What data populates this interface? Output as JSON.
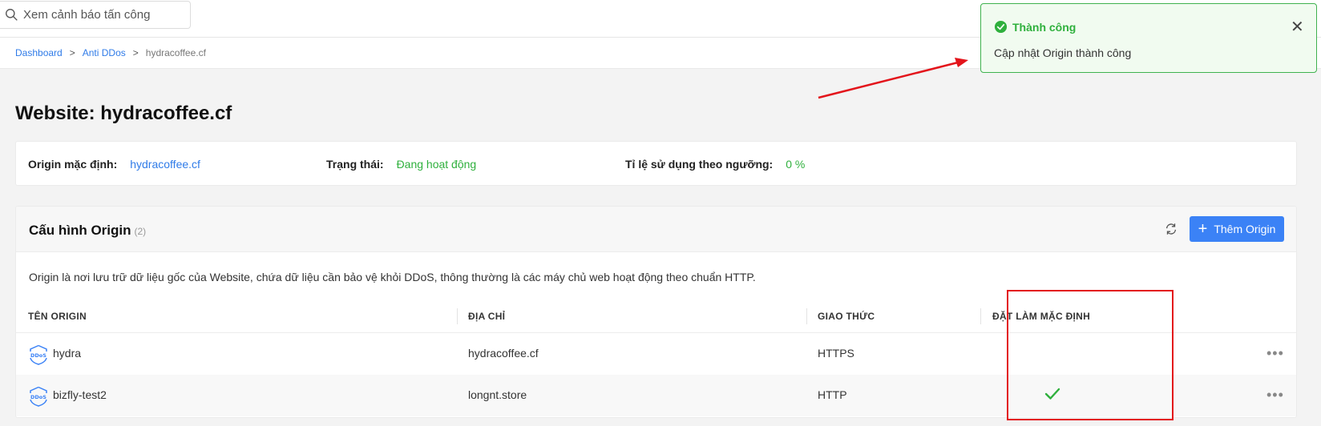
{
  "search": {
    "placeholder": "Xem cảnh báo tấn công"
  },
  "breadcrumb": {
    "items": [
      "Dashboard",
      "Anti DDos"
    ],
    "separator": ">",
    "current": "hydracoffee.cf"
  },
  "page": {
    "title": "Website: hydracoffee.cf"
  },
  "info": {
    "origin_label": "Origin mặc định:",
    "origin_value": "hydracoffee.cf",
    "status_label": "Trạng thái:",
    "status_value": "Đang hoạt động",
    "usage_label": "Tỉ lệ sử dụng theo ngưỡng:",
    "usage_value": "0 %"
  },
  "config": {
    "title": "Cấu hình Origin",
    "count": "(2)",
    "add_button": "Thêm Origin",
    "description": "Origin là nơi lưu trữ dữ liệu gốc của Website, chứa dữ liệu cần bảo vệ khỏi DDoS, thông thường là các máy chủ web hoạt động theo chuẩn HTTP."
  },
  "table": {
    "columns": [
      "TÊN ORIGIN",
      "ĐỊA CHỈ",
      "GIAO THỨC",
      "ĐẶT LÀM MẶC ĐỊNH"
    ],
    "rows": [
      {
        "name": "hydra",
        "address": "hydracoffee.cf",
        "protocol": "HTTPS",
        "is_default": false
      },
      {
        "name": "bizfly-test2",
        "address": "longnt.store",
        "protocol": "HTTP",
        "is_default": true
      }
    ]
  },
  "toast": {
    "title": "Thành công",
    "message": "Cập nhật Origin thành công"
  },
  "colors": {
    "accent": "#3b82f6",
    "success": "#2fb03d",
    "annotation": "#e3141b"
  },
  "icons": {
    "ddos": "ddos-shield-icon",
    "more": "more-horizontal-icon",
    "check": "check-icon",
    "refresh": "refresh-icon",
    "search": "search-icon",
    "close": "close-icon"
  }
}
